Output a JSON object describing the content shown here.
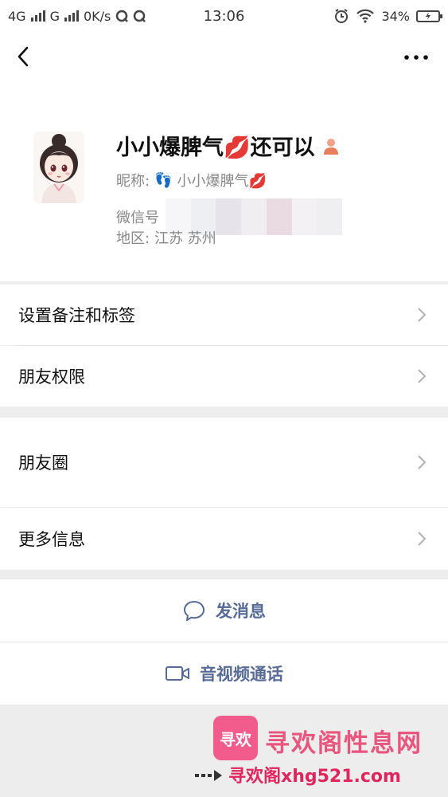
{
  "status_bar": {
    "network1": "4G",
    "network2": "G",
    "speed": "0K/s",
    "time": "13:06",
    "battery": "34%"
  },
  "profile": {
    "display_name": "小小爆脾气💋还可以",
    "nickname_label": "昵称:",
    "nickname_value": "小小爆脾气💋",
    "wechat_id_label": "微信号",
    "region_label": "地区:",
    "region_value": "江苏  苏州",
    "footprints_icon": "👣"
  },
  "menu": {
    "remark_tags": "设置备注和标签",
    "friend_permissions": "朋友权限",
    "moments": "朋友圈",
    "more_info": "更多信息"
  },
  "actions": {
    "send_message": "发消息",
    "video_call": "音视频通话"
  },
  "watermark": {
    "logo_text": "寻欢",
    "title": "寻欢阁性息网",
    "url": "寻欢阁xhg521.com"
  },
  "colors": {
    "link_blue": "#576b95",
    "background_gray": "#ededed",
    "watermark_pink": "#e8567f"
  }
}
